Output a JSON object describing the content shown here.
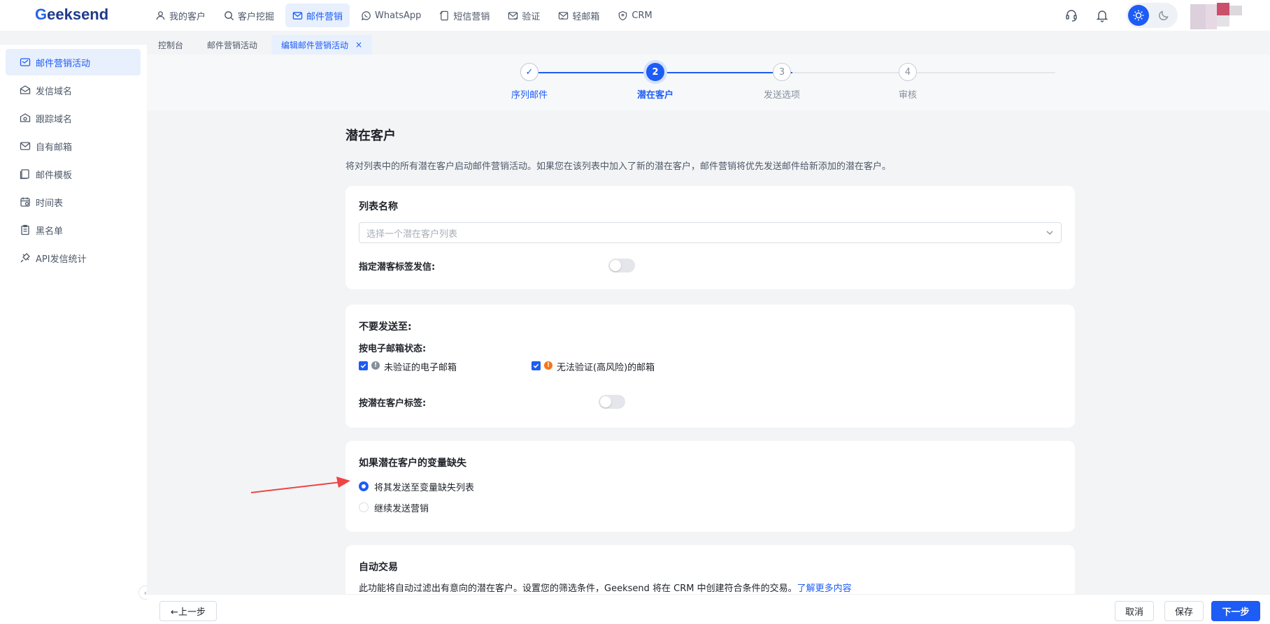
{
  "brand": {
    "logo_text": "eeksend",
    "logo_letter": "G"
  },
  "top_nav": [
    {
      "label": "我的客户",
      "icon": "user-icon"
    },
    {
      "label": "客户挖掘",
      "icon": "search-icon"
    },
    {
      "label": "邮件营销",
      "icon": "mail-icon",
      "active": true
    },
    {
      "label": "WhatsApp",
      "icon": "whatsapp-icon"
    },
    {
      "label": "短信营销",
      "icon": "sms-icon"
    },
    {
      "label": "验证",
      "icon": "verify-mail-icon"
    },
    {
      "label": "轻邮箱",
      "icon": "light-mail-icon"
    },
    {
      "label": "CRM",
      "icon": "crm-icon"
    }
  ],
  "tabs": [
    {
      "label": "控制台"
    },
    {
      "label": "邮件营销活动"
    },
    {
      "label": "编辑邮件营销活动",
      "active": true,
      "close": "×"
    }
  ],
  "sidebar": [
    {
      "label": "邮件营销活动",
      "icon": "campaign-icon",
      "active": true
    },
    {
      "label": "发信域名",
      "icon": "domain-icon"
    },
    {
      "label": "跟踪域名",
      "icon": "tracking-icon"
    },
    {
      "label": "自有邮箱",
      "icon": "mailbox-icon"
    },
    {
      "label": "邮件模板",
      "icon": "template-icon"
    },
    {
      "label": "时间表",
      "icon": "calendar-icon"
    },
    {
      "label": "黑名单",
      "icon": "blacklist-icon"
    },
    {
      "label": "API发信统计",
      "icon": "api-icon"
    }
  ],
  "stepper": [
    {
      "label": "序列邮件",
      "number": "✓",
      "state": "done"
    },
    {
      "label": "潜在客户",
      "number": "2",
      "state": "current"
    },
    {
      "label": "发送选项",
      "number": "3",
      "state": "todo"
    },
    {
      "label": "审核",
      "number": "4",
      "state": "todo"
    }
  ],
  "page": {
    "title": "潜在客户",
    "description": "将对列表中的所有潜在客户启动邮件营销活动。如果您在该列表中加入了新的潜在客户，邮件营销将优先发送邮件给新添加的潜在客户。"
  },
  "list_card": {
    "title": "列表名称",
    "select_placeholder": "选择一个潜在客户列表",
    "tag_send_label": "指定潜客标签发信:",
    "tag_send_enabled": false
  },
  "exclude_card": {
    "title": "不要发送至:",
    "by_status_label": "按电子邮箱状态:",
    "checkbox_unverified": "未验证的电子邮箱",
    "checkbox_unverifiable": "无法验证(高风险)的邮箱",
    "unverified_checked": true,
    "unverifiable_checked": true,
    "by_tag_label": "按潜在客户标签:",
    "by_tag_enabled": false
  },
  "missing_var_card": {
    "title": "如果潜在客户的变量缺失",
    "option_send_to_list": "将其发送至变量缺失列表",
    "option_continue": "继续发送营销",
    "selected": "option_send_to_list"
  },
  "auto_deal_card": {
    "title": "自动交易",
    "description": "此功能将自动过滤出有意向的潜在客户。设置您的筛选条件，Geeksend 将在 CRM 中创建符合条件的交易。",
    "learn_more": "了解更多内容"
  },
  "footer": {
    "prev": "←上一步",
    "cancel": "取消",
    "save": "保存",
    "next": "下一步"
  },
  "colors": {
    "accent": "#1d5cf5",
    "annotation_arrow": "#ef4444",
    "warning": "#f97316"
  }
}
